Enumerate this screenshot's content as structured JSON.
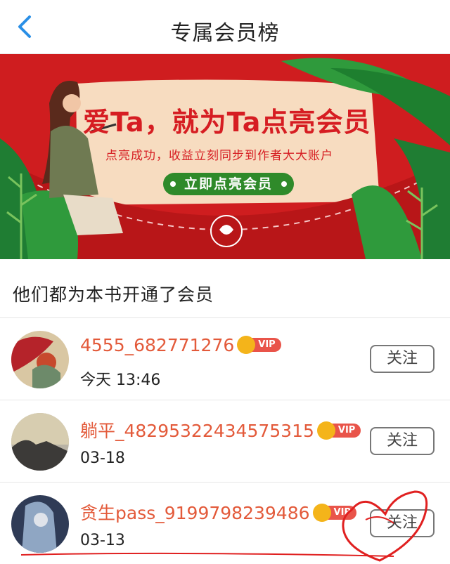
{
  "header": {
    "title": "专属会员榜"
  },
  "banner": {
    "headline": "爱Ta，就为Ta点亮会员",
    "subtitle": "点亮成功，收益立刻同步到作者大大账户",
    "button_label": "立即点亮会员"
  },
  "section": {
    "title": "他们都为本书开通了会员"
  },
  "members": [
    {
      "name": "4555_682771276",
      "badge": "VIP",
      "time": "今天 13:46",
      "follow": "关注"
    },
    {
      "name": "躺平_48295322434575315",
      "badge": "VIP",
      "time": "03-18",
      "follow": "关注"
    },
    {
      "name": "贪生pass_9199798239486",
      "badge": "VIP",
      "time": "03-13",
      "follow": "关注"
    }
  ],
  "colors": {
    "accent_red": "#d01f1f",
    "name_color": "#e35a3a",
    "banner_button": "#2f8a2a"
  }
}
